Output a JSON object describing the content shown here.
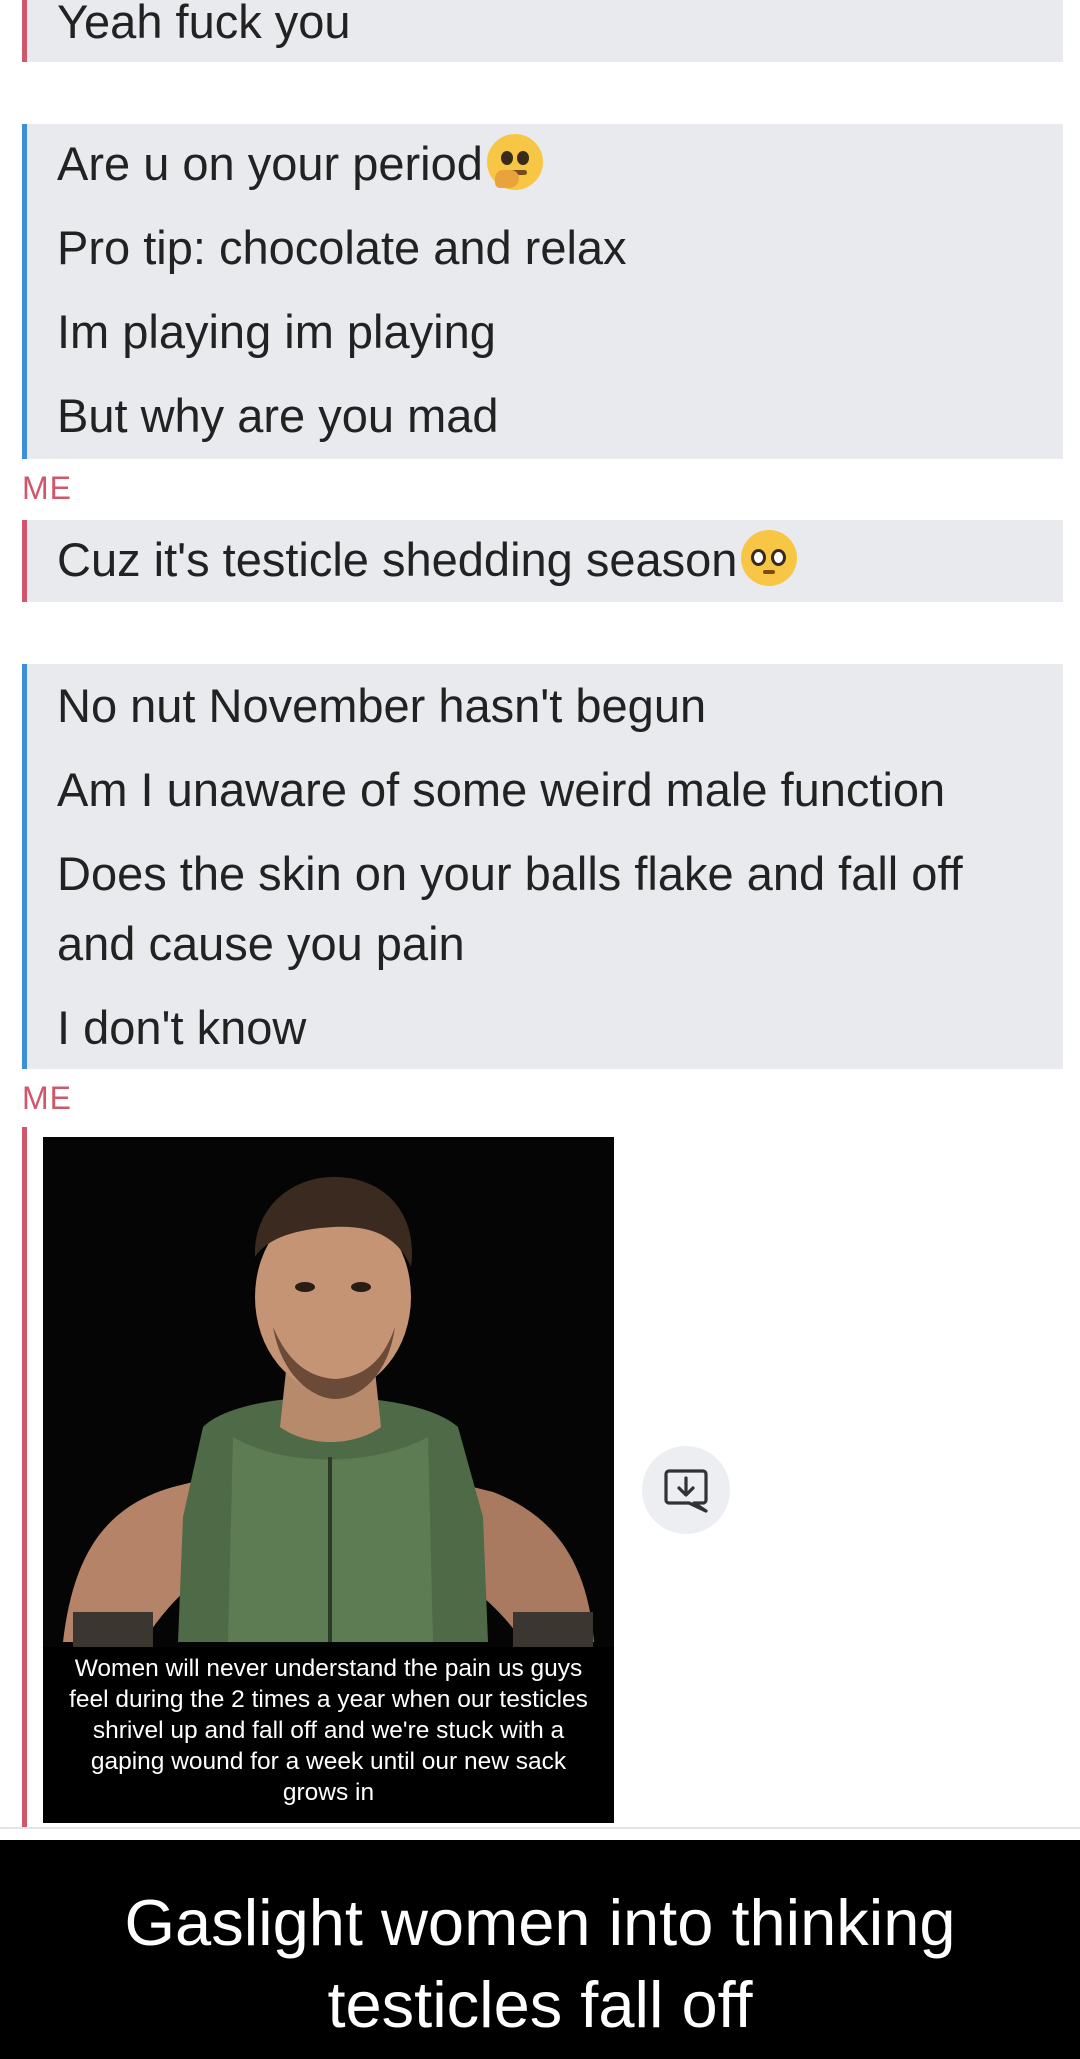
{
  "conversation": {
    "me_block_1": {
      "lines": [
        "Yeah fuck you"
      ]
    },
    "them_block_1": {
      "lines": [
        "Are u on your period",
        "Pro tip: chocolate and relax",
        "Im playing im playing",
        "But why are you mad"
      ],
      "line1_emoji": "thinking-face-emoji"
    },
    "me_label_1": "ME",
    "me_block_2": {
      "lines": [
        "Cuz it's testicle shedding season"
      ],
      "line1_emoji": "pleading-face-emoji"
    },
    "them_block_2": {
      "lines": [
        "No nut November hasn't begun",
        "Am I unaware of some weird male function",
        "Does the skin on your balls flake and fall off",
        "and cause you pain",
        "I don't know"
      ]
    },
    "me_label_2": "ME",
    "meme": {
      "caption": "Women will never understand the pain us guys feel during the 2 times a year when our testicles shrivel up and fall off and we're stuck with a gaping wound for a week until our new sack grows in"
    },
    "save_icon": "download-icon"
  },
  "banner": {
    "line1": "Gaslight women into thinking",
    "line2": "testicles fall off"
  },
  "colors": {
    "me_accent": "#d0566b",
    "them_accent": "#3d8ed9",
    "bubble_bg": "#e8eaee",
    "banner_bg": "#000000"
  }
}
